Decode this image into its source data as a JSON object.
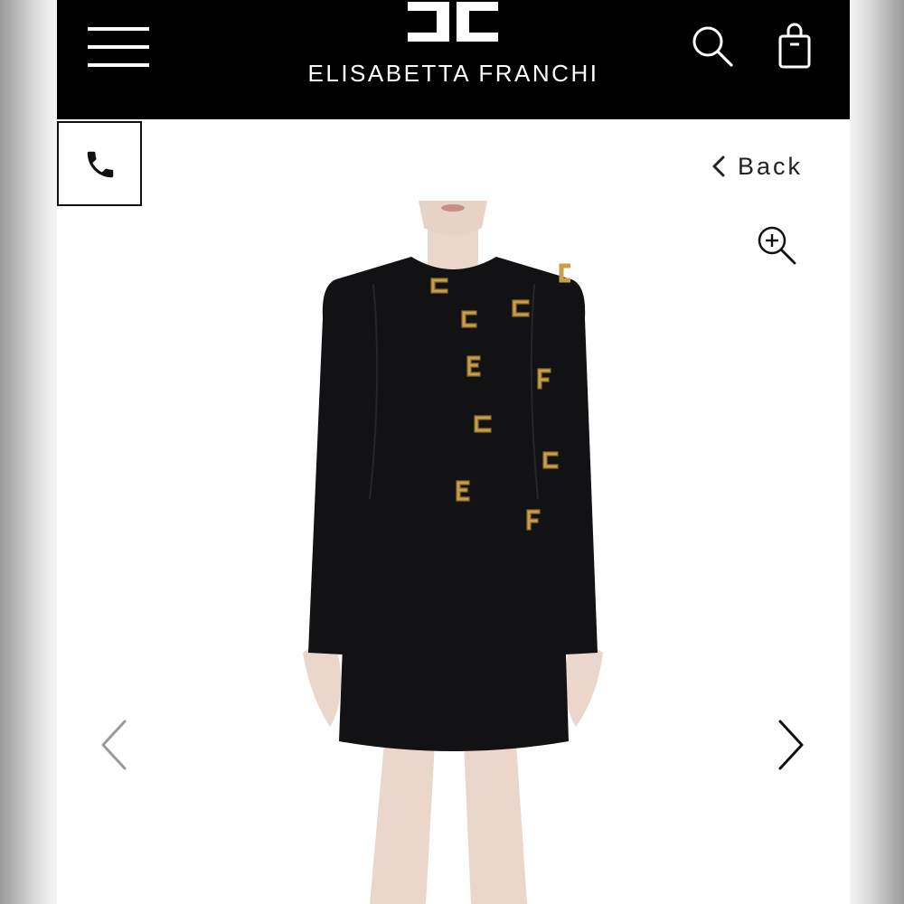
{
  "header": {
    "brand": "ELISABETTA FRANCHI",
    "logo_icon": "ef-monogram-logo",
    "menu_icon": "hamburger-menu-icon",
    "search_icon": "search-icon",
    "bag_icon": "shopping-bag-icon"
  },
  "contact": {
    "phone_icon": "phone-icon"
  },
  "navigation": {
    "back_label": "Back",
    "back_icon": "chevron-left-icon"
  },
  "gallery": {
    "zoom_icon": "zoom-in-icon",
    "prev_icon": "chevron-left-icon",
    "next_icon": "chevron-right-icon",
    "image": "black long-sleeve mini dress with gold logo charms"
  },
  "colors": {
    "header_bg": "#000000",
    "header_text": "#ffffff",
    "page_bg": "#ffffff",
    "dress": "#121214",
    "charms": "#c9a04a"
  }
}
